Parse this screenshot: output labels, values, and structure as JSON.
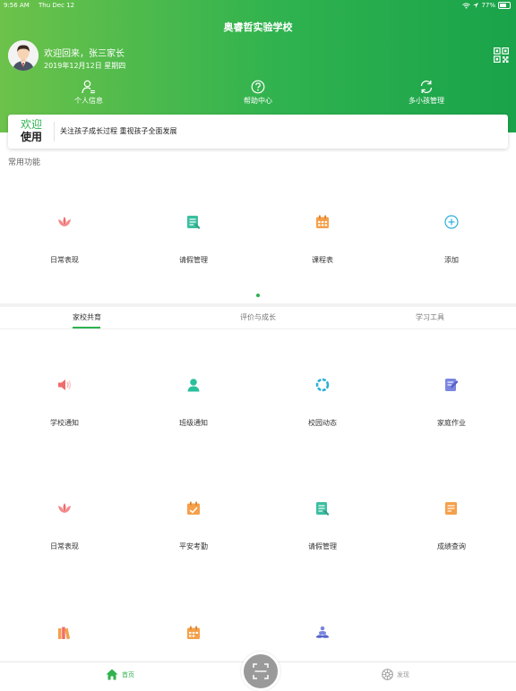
{
  "status_bar": {
    "time": "9:56 AM",
    "date": "Thu Dec 12",
    "battery": "77%"
  },
  "header": {
    "school_name": "奥睿哲实验学校",
    "welcome": "欢迎回来，张三家长",
    "date": "2019年12月12日 星期四",
    "nav": [
      {
        "label": "个人信息",
        "icon": "person-info-icon"
      },
      {
        "label": "帮助中心",
        "icon": "help-icon"
      },
      {
        "label": "多小孩管理",
        "icon": "switch-child-icon"
      }
    ]
  },
  "banner": {
    "badge_line1": "欢迎",
    "badge_line2": "使用",
    "text": "关注孩子成长过程  重视孩子全面发展"
  },
  "common": {
    "title": "常用功能",
    "items": [
      {
        "label": "日常表现",
        "icon": "lotus-icon"
      },
      {
        "label": "请假管理",
        "icon": "leave-doc-icon"
      },
      {
        "label": "课程表",
        "icon": "calendar-icon"
      },
      {
        "label": "添加",
        "icon": "add-circle-icon"
      }
    ]
  },
  "tabs": [
    {
      "label": "家校共育",
      "active": true
    },
    {
      "label": "评价与成长",
      "active": false
    },
    {
      "label": "学习工具",
      "active": false
    }
  ],
  "tab_grid": {
    "row1": [
      {
        "label": "学校通知",
        "icon": "speaker-icon"
      },
      {
        "label": "班级通知",
        "icon": "person-icon"
      },
      {
        "label": "校园动态",
        "icon": "refresh-ring-icon"
      },
      {
        "label": "家庭作业",
        "icon": "homework-icon"
      }
    ],
    "row2": [
      {
        "label": "日常表现",
        "icon": "lotus-icon"
      },
      {
        "label": "平安考勤",
        "icon": "attendance-icon"
      },
      {
        "label": "请假管理",
        "icon": "leave-doc-icon"
      },
      {
        "label": "成绩查询",
        "icon": "score-icon"
      }
    ],
    "row3": [
      {
        "label": "",
        "icon": "books-icon"
      },
      {
        "label": "",
        "icon": "calendar-icon"
      },
      {
        "label": "",
        "icon": "meditation-icon"
      }
    ]
  },
  "bottom_bar": {
    "home": "首页",
    "discover": "发现"
  },
  "colors": {
    "brand_green": "#2fb24f",
    "accent_orange": "#f5a04a",
    "accent_red": "#f06c6c"
  }
}
